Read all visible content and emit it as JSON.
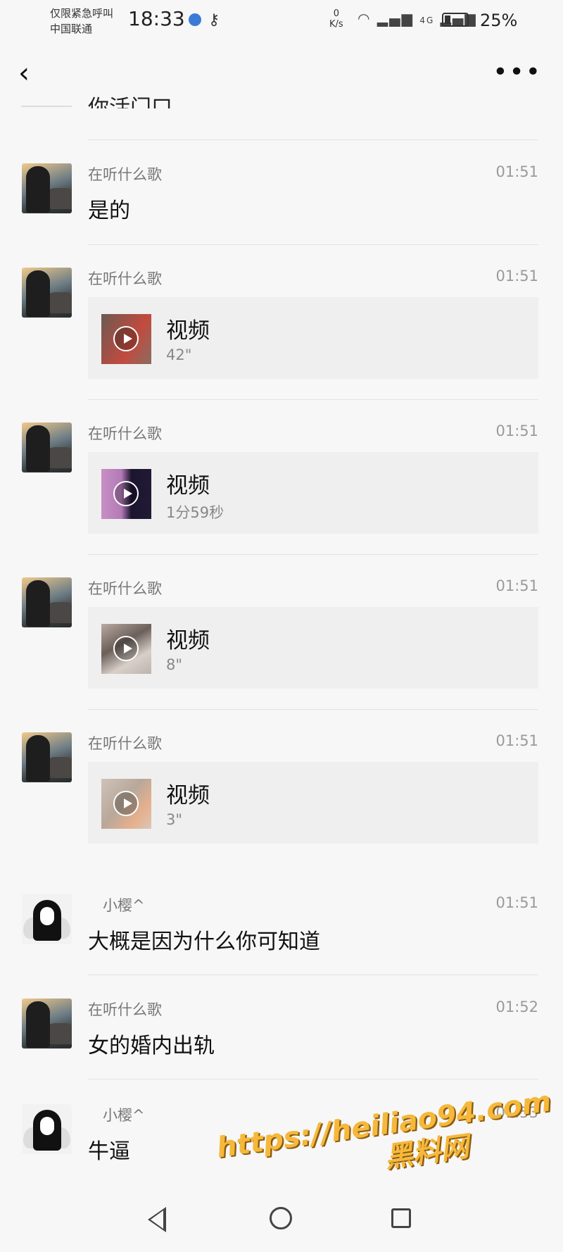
{
  "status": {
    "carrier_line1": "仅限紧急呼叫",
    "carrier_line2": "中国联通",
    "time": "18:33",
    "net_speed_value": "0",
    "net_speed_unit": "K/s",
    "network_type": "4G",
    "battery": "25%"
  },
  "top_clip_text": "你活门口",
  "messages": [
    {
      "avatar": "dark",
      "sender": "在听什么歌",
      "time": "01:51",
      "type": "text",
      "text": "是的"
    },
    {
      "avatar": "dark",
      "sender": "在听什么歌",
      "time": "01:51",
      "type": "video",
      "title": "视频",
      "duration": "42\""
    },
    {
      "avatar": "dark",
      "sender": "在听什么歌",
      "time": "01:51",
      "type": "video",
      "title": "视频",
      "duration": "1分59秒"
    },
    {
      "avatar": "dark",
      "sender": "在听什么歌",
      "time": "01:51",
      "type": "video",
      "title": "视频",
      "duration": "8\""
    },
    {
      "avatar": "dark",
      "sender": "在听什么歌",
      "time": "01:51",
      "type": "video",
      "title": "视频",
      "duration": "3\""
    },
    {
      "avatar": "girl",
      "sender": "小樱^",
      "time": "01:51",
      "type": "text",
      "text": "大概是因为什么你可知道"
    },
    {
      "avatar": "dark",
      "sender": "在听什么歌",
      "time": "01:52",
      "type": "text",
      "text": "女的婚内出轨"
    },
    {
      "avatar": "girl",
      "sender": "小樱^",
      "time": "01:53",
      "type": "text",
      "text": "牛逼"
    }
  ],
  "watermark": {
    "url": "https://heiliao94.com",
    "name": "黑料网"
  },
  "colors": {
    "background": "#f7f7f7",
    "card": "#efefef",
    "watermark": "#f5b83a"
  }
}
